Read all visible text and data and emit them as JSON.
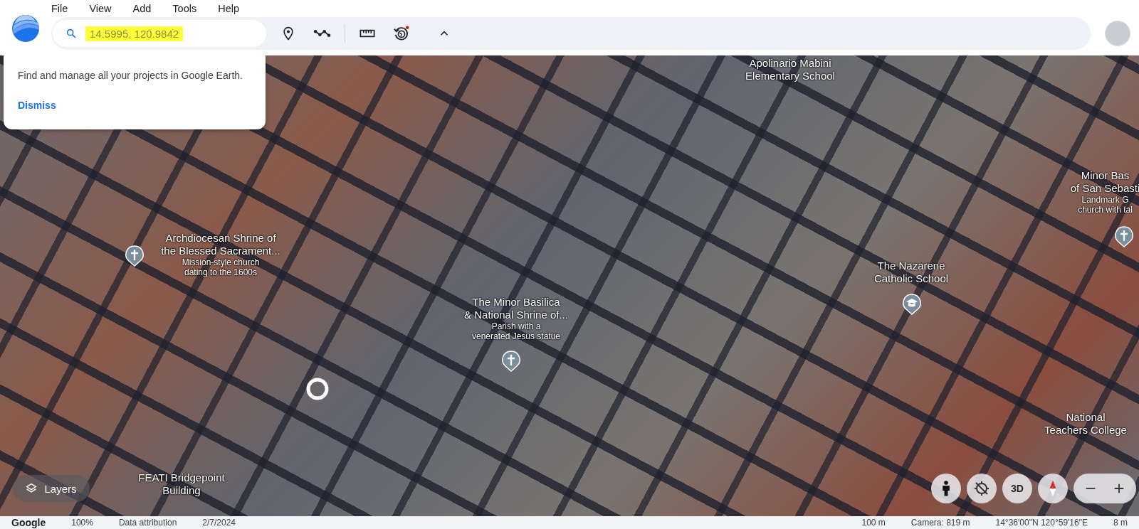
{
  "menu": [
    "File",
    "View",
    "Add",
    "Tools",
    "Help"
  ],
  "search": {
    "value": "14.5995, 120.9842",
    "highlighted": true
  },
  "popup": {
    "message": "Find and manage all your projects in Google Earth.",
    "action": "Dismiss"
  },
  "map_labels": [
    {
      "title": [
        "Apolinario Mabini",
        "Elementary School"
      ]
    },
    {
      "title": [
        "Minor Bas",
        "of San Sebasti"
      ],
      "description": [
        "Landmark G",
        "church with tal"
      ]
    },
    {
      "title": [
        "Archdiocesan Shrine of",
        "the Blessed Sacrament..."
      ],
      "description": [
        "Mission-style church",
        "dating to the 1600s"
      ]
    },
    {
      "title": [
        "The Nazarene",
        "Catholic School"
      ]
    },
    {
      "title": [
        "The Minor Basilica",
        "& National Shrine of..."
      ],
      "description": [
        "Parish with a",
        "venerated Jesus statue"
      ]
    },
    {
      "title": [
        "National",
        "Teachers College"
      ]
    },
    {
      "title": [
        "FEATI Bridgepoint",
        "Building"
      ]
    }
  ],
  "pins": [
    {
      "kind": "church"
    },
    {
      "kind": "church"
    },
    {
      "kind": "school"
    },
    {
      "kind": "church"
    }
  ],
  "layers_button": "Layers",
  "view_button": "3D",
  "status_bar": {
    "brand": "Google",
    "zoom": "100%",
    "attribution": "Data attribution",
    "date": "2/7/2024",
    "scale": "100 m",
    "camera": "Camera: 819 m",
    "coordinates": "14°36'00\"N 120°59'16\"E",
    "elevation": "8 m"
  }
}
